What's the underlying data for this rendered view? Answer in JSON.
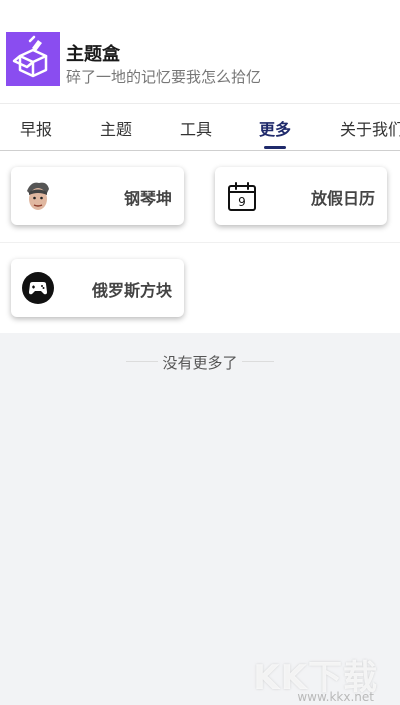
{
  "app": {
    "title": "主题盒",
    "subtitle": "碎了一地的记忆要我怎么拾亿"
  },
  "tabs": [
    {
      "label": "早报"
    },
    {
      "label": "主题"
    },
    {
      "label": "工具"
    },
    {
      "label": "更多",
      "active": true
    },
    {
      "label": "关于我们"
    }
  ],
  "cards": [
    {
      "label": "钢琴坤",
      "icon": "avatar-meme-icon"
    },
    {
      "label": "放假日历",
      "icon": "calendar-icon",
      "icon_text": "9"
    },
    {
      "label": "俄罗斯方块",
      "icon": "gamepad-icon"
    }
  ],
  "empty_note": "没有更多了",
  "watermark": {
    "brand": "KK下载",
    "url": "www.kkx.net"
  },
  "colors": {
    "accent": "#1f2a6b",
    "app_icon_bg": "#8a4df0",
    "page_bg": "#f2f3f5"
  }
}
